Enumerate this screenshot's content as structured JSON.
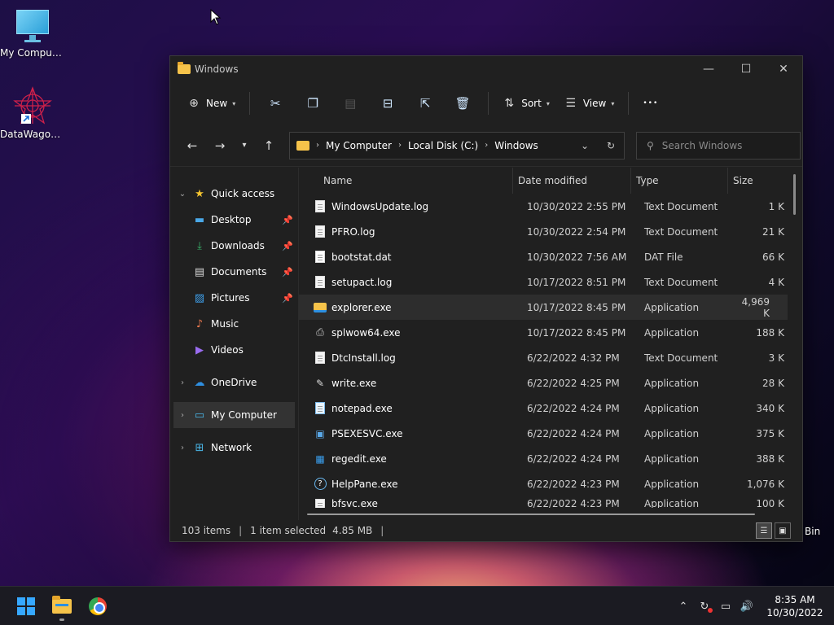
{
  "desktop": {
    "icons": [
      {
        "label": "My Computer"
      },
      {
        "label": "DataWagon..."
      }
    ],
    "recycle_bin_label": "Bin"
  },
  "window": {
    "title": "Windows",
    "controls": {
      "minimize": "—",
      "maximize": "☐",
      "close": "✕"
    }
  },
  "toolbar": {
    "new_label": "New",
    "sort_label": "Sort",
    "view_label": "View",
    "more_label": "•••"
  },
  "address": {
    "crumbs": [
      "My Computer",
      "Local Disk (C:)",
      "Windows"
    ]
  },
  "search": {
    "placeholder": "Search Windows"
  },
  "nav_pane": {
    "quick_access": "Quick access",
    "items": [
      {
        "label": "Desktop"
      },
      {
        "label": "Downloads"
      },
      {
        "label": "Documents"
      },
      {
        "label": "Pictures"
      },
      {
        "label": "Music"
      },
      {
        "label": "Videos"
      }
    ],
    "onedrive": "OneDrive",
    "my_computer": "My Computer",
    "network": "Network"
  },
  "columns": {
    "name": "Name",
    "date": "Date modified",
    "type": "Type",
    "size": "Size"
  },
  "files": [
    {
      "name": "WindowsUpdate.log",
      "date": "10/30/2022 2:55 PM",
      "type": "Text Document",
      "size": "1 K"
    },
    {
      "name": "PFRO.log",
      "date": "10/30/2022 2:54 PM",
      "type": "Text Document",
      "size": "21 K"
    },
    {
      "name": "bootstat.dat",
      "date": "10/30/2022 7:56 AM",
      "type": "DAT File",
      "size": "66 K"
    },
    {
      "name": "setupact.log",
      "date": "10/17/2022 8:51 PM",
      "type": "Text Document",
      "size": "4 K"
    },
    {
      "name": "explorer.exe",
      "date": "10/17/2022 8:45 PM",
      "type": "Application",
      "size": "4,969 K"
    },
    {
      "name": "splwow64.exe",
      "date": "10/17/2022 8:45 PM",
      "type": "Application",
      "size": "188 K"
    },
    {
      "name": "DtcInstall.log",
      "date": "6/22/2022 4:32 PM",
      "type": "Text Document",
      "size": "3 K"
    },
    {
      "name": "write.exe",
      "date": "6/22/2022 4:25 PM",
      "type": "Application",
      "size": "28 K"
    },
    {
      "name": "notepad.exe",
      "date": "6/22/2022 4:24 PM",
      "type": "Application",
      "size": "340 K"
    },
    {
      "name": "PSEXESVC.exe",
      "date": "6/22/2022 4:24 PM",
      "type": "Application",
      "size": "375 K"
    },
    {
      "name": "regedit.exe",
      "date": "6/22/2022 4:24 PM",
      "type": "Application",
      "size": "388 K"
    },
    {
      "name": "HelpPane.exe",
      "date": "6/22/2022 4:23 PM",
      "type": "Application",
      "size": "1,076 K"
    },
    {
      "name": "bfsvc.exe",
      "date": "6/22/2022 4:23 PM",
      "type": "Application",
      "size": "100 K"
    }
  ],
  "status": {
    "items": "103 items",
    "selected": "1 item selected",
    "size": "4.85 MB"
  },
  "taskbar": {
    "time": "8:35 AM",
    "date": "10/30/2022"
  }
}
